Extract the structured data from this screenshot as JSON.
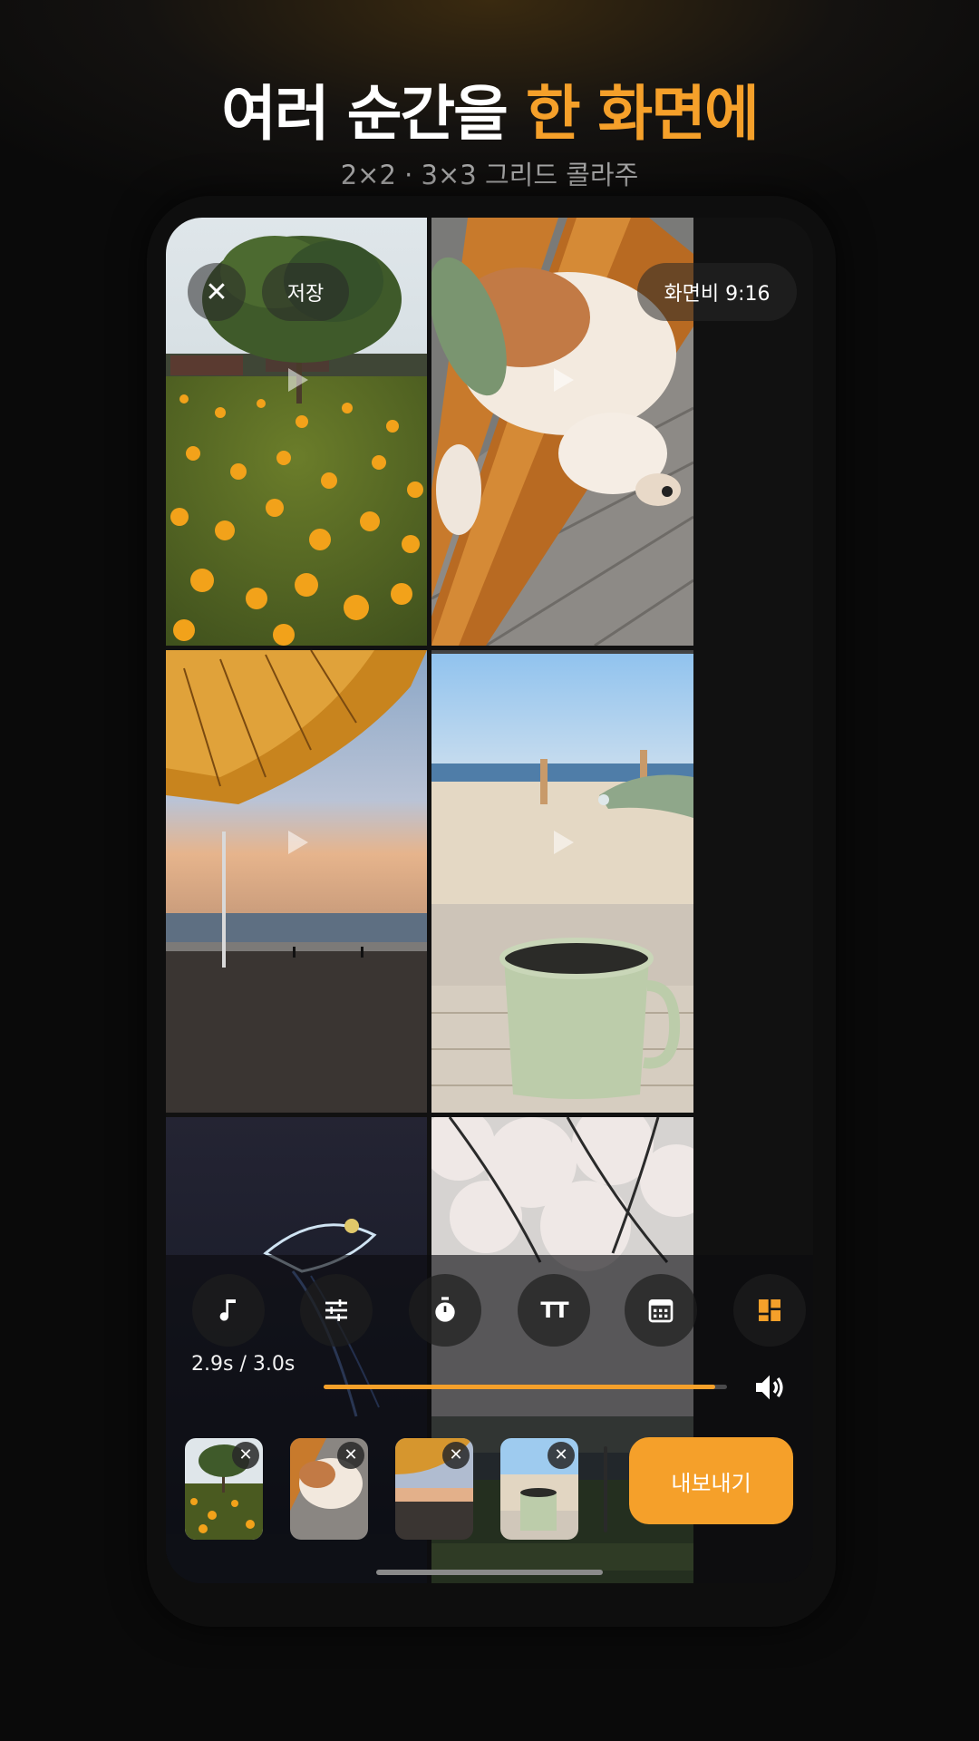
{
  "header": {
    "title_plain": "여러 순간을",
    "title_accent": "한 화면에",
    "subtitle": "2×2 · 3×3 그리드 콜라주"
  },
  "editor": {
    "save_label": "저장",
    "aspect_ratio_label": "화면비 9:16",
    "time_display": "2.9s / 3.0s",
    "progress_fraction": 0.97,
    "export_label": "내보내기",
    "tools": [
      {
        "icon": "music-note-icon"
      },
      {
        "icon": "adjust-sliders-icon"
      },
      {
        "icon": "timer-icon"
      },
      {
        "icon": "text-icon"
      },
      {
        "icon": "calendar-icon"
      },
      {
        "icon": "grid-layout-icon"
      }
    ],
    "tool_text_glyph": "TT",
    "remove_glyph": "✕",
    "close_glyph": "✕"
  },
  "colors": {
    "accent": "#f5a02a",
    "background": "#0a0a0a",
    "subtitle": "#a8a8a8"
  }
}
